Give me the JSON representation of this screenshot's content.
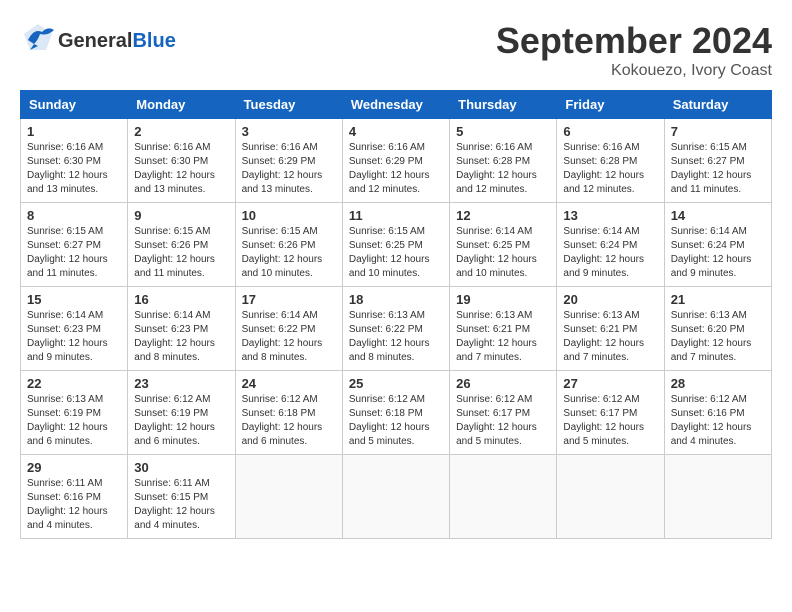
{
  "logo": {
    "general": "General",
    "blue": "Blue"
  },
  "title": "September 2024",
  "location": "Kokouezo, Ivory Coast",
  "days_header": [
    "Sunday",
    "Monday",
    "Tuesday",
    "Wednesday",
    "Thursday",
    "Friday",
    "Saturday"
  ],
  "weeks": [
    [
      {
        "day": "1",
        "sunrise": "6:16 AM",
        "sunset": "6:30 PM",
        "daylight": "12 hours and 13 minutes."
      },
      {
        "day": "2",
        "sunrise": "6:16 AM",
        "sunset": "6:30 PM",
        "daylight": "12 hours and 13 minutes."
      },
      {
        "day": "3",
        "sunrise": "6:16 AM",
        "sunset": "6:29 PM",
        "daylight": "12 hours and 13 minutes."
      },
      {
        "day": "4",
        "sunrise": "6:16 AM",
        "sunset": "6:29 PM",
        "daylight": "12 hours and 12 minutes."
      },
      {
        "day": "5",
        "sunrise": "6:16 AM",
        "sunset": "6:28 PM",
        "daylight": "12 hours and 12 minutes."
      },
      {
        "day": "6",
        "sunrise": "6:16 AM",
        "sunset": "6:28 PM",
        "daylight": "12 hours and 12 minutes."
      },
      {
        "day": "7",
        "sunrise": "6:15 AM",
        "sunset": "6:27 PM",
        "daylight": "12 hours and 11 minutes."
      }
    ],
    [
      {
        "day": "8",
        "sunrise": "6:15 AM",
        "sunset": "6:27 PM",
        "daylight": "12 hours and 11 minutes."
      },
      {
        "day": "9",
        "sunrise": "6:15 AM",
        "sunset": "6:26 PM",
        "daylight": "12 hours and 11 minutes."
      },
      {
        "day": "10",
        "sunrise": "6:15 AM",
        "sunset": "6:26 PM",
        "daylight": "12 hours and 10 minutes."
      },
      {
        "day": "11",
        "sunrise": "6:15 AM",
        "sunset": "6:25 PM",
        "daylight": "12 hours and 10 minutes."
      },
      {
        "day": "12",
        "sunrise": "6:14 AM",
        "sunset": "6:25 PM",
        "daylight": "12 hours and 10 minutes."
      },
      {
        "day": "13",
        "sunrise": "6:14 AM",
        "sunset": "6:24 PM",
        "daylight": "12 hours and 9 minutes."
      },
      {
        "day": "14",
        "sunrise": "6:14 AM",
        "sunset": "6:24 PM",
        "daylight": "12 hours and 9 minutes."
      }
    ],
    [
      {
        "day": "15",
        "sunrise": "6:14 AM",
        "sunset": "6:23 PM",
        "daylight": "12 hours and 9 minutes."
      },
      {
        "day": "16",
        "sunrise": "6:14 AM",
        "sunset": "6:23 PM",
        "daylight": "12 hours and 8 minutes."
      },
      {
        "day": "17",
        "sunrise": "6:14 AM",
        "sunset": "6:22 PM",
        "daylight": "12 hours and 8 minutes."
      },
      {
        "day": "18",
        "sunrise": "6:13 AM",
        "sunset": "6:22 PM",
        "daylight": "12 hours and 8 minutes."
      },
      {
        "day": "19",
        "sunrise": "6:13 AM",
        "sunset": "6:21 PM",
        "daylight": "12 hours and 7 minutes."
      },
      {
        "day": "20",
        "sunrise": "6:13 AM",
        "sunset": "6:21 PM",
        "daylight": "12 hours and 7 minutes."
      },
      {
        "day": "21",
        "sunrise": "6:13 AM",
        "sunset": "6:20 PM",
        "daylight": "12 hours and 7 minutes."
      }
    ],
    [
      {
        "day": "22",
        "sunrise": "6:13 AM",
        "sunset": "6:19 PM",
        "daylight": "12 hours and 6 minutes."
      },
      {
        "day": "23",
        "sunrise": "6:12 AM",
        "sunset": "6:19 PM",
        "daylight": "12 hours and 6 minutes."
      },
      {
        "day": "24",
        "sunrise": "6:12 AM",
        "sunset": "6:18 PM",
        "daylight": "12 hours and 6 minutes."
      },
      {
        "day": "25",
        "sunrise": "6:12 AM",
        "sunset": "6:18 PM",
        "daylight": "12 hours and 5 minutes."
      },
      {
        "day": "26",
        "sunrise": "6:12 AM",
        "sunset": "6:17 PM",
        "daylight": "12 hours and 5 minutes."
      },
      {
        "day": "27",
        "sunrise": "6:12 AM",
        "sunset": "6:17 PM",
        "daylight": "12 hours and 5 minutes."
      },
      {
        "day": "28",
        "sunrise": "6:12 AM",
        "sunset": "6:16 PM",
        "daylight": "12 hours and 4 minutes."
      }
    ],
    [
      {
        "day": "29",
        "sunrise": "6:11 AM",
        "sunset": "6:16 PM",
        "daylight": "12 hours and 4 minutes."
      },
      {
        "day": "30",
        "sunrise": "6:11 AM",
        "sunset": "6:15 PM",
        "daylight": "12 hours and 4 minutes."
      },
      null,
      null,
      null,
      null,
      null
    ]
  ]
}
